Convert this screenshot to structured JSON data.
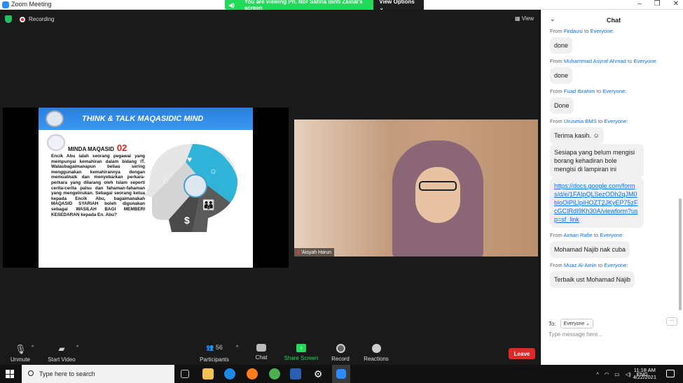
{
  "window": {
    "title": "Zoom Meeting",
    "minimize": "–",
    "restore": "❐",
    "close": "✕"
  },
  "banner": {
    "text": "You are viewing Pn. Nor Safina Binti Zainal's screen",
    "view_options": "View Options ⌄"
  },
  "meeting": {
    "recording": "Recording",
    "view": "View"
  },
  "slide": {
    "title": "THINK & TALK MAQASIDIC MIND",
    "heading": "MINDA MAQASID",
    "number": "02",
    "body": "Encik Abu ialah seorang pegawai yang mempunyai kemahiran dalam bidang IT. Walaubagaimanapun beliau sering menggunakan kemahirannya dengan memuatnaik dan menyebarkan perkara-perkara yang dilarang oleh Islam seperti cerita-cerita palsu dan fahaman-fahaman yang mengelirukan. Sebagai seorang ketua kepada Encik Abu, bagaimanakah MAQASID SYARIAH boleh digunakan sebagai WASILAH BAGI MEMBERI KESEDARAN kepada En. Abu?"
  },
  "video": {
    "participant_name": "'Aisyah Harun"
  },
  "toolbar": {
    "unmute": "Unmute",
    "start_video": "Start Video",
    "participants": "Participants",
    "participants_count": "56",
    "chat": "Chat",
    "share_screen": "Share Screen",
    "record": "Record",
    "reactions": "Reactions",
    "leave": "Leave"
  },
  "chat": {
    "title": "Chat",
    "messages": [
      {
        "from": "Firdausi",
        "to": "Everyone:",
        "texts": [
          "done"
        ]
      },
      {
        "from": "Muhammad Asyraf Ahmad",
        "to": "Everyone:",
        "texts": [
          "done"
        ]
      },
      {
        "from": "Fuad Ibrahim",
        "to": "Everyone:",
        "texts": [
          "Done"
        ]
      },
      {
        "from": "Urusetia BMS",
        "to": "Everyone:",
        "texts": [
          "Terima kasih. ☺",
          "Sesiapa yang belum mengisi borang kehadiran bole mengisi di lampiran ini"
        ],
        "link": "https://docs.google.com/forms/d/e/1FAIpQLSezODh2qJM0bloOiPlLlpiHOZT2JKyEP75zFcGCIRdI9Kh30A/viewform?usp=sf_link"
      },
      {
        "from": "Aiman Rafie",
        "to": "Everyone:",
        "texts": [
          "Mohamad Najib nak cuba"
        ]
      },
      {
        "from": "Muaz Al-Amin",
        "to": "Everyone:",
        "texts": [
          "Terbaik ust Mohamad Najib"
        ]
      }
    ],
    "from_label": "From",
    "to_word": "to",
    "to_label": "To:",
    "to_value": "Everyone ⌄",
    "more": "···",
    "placeholder": "Type message here..."
  },
  "taskbar": {
    "search": "Type here to search",
    "lang": "ENG",
    "time": "11:18 AM",
    "date": "4/22/2021"
  }
}
